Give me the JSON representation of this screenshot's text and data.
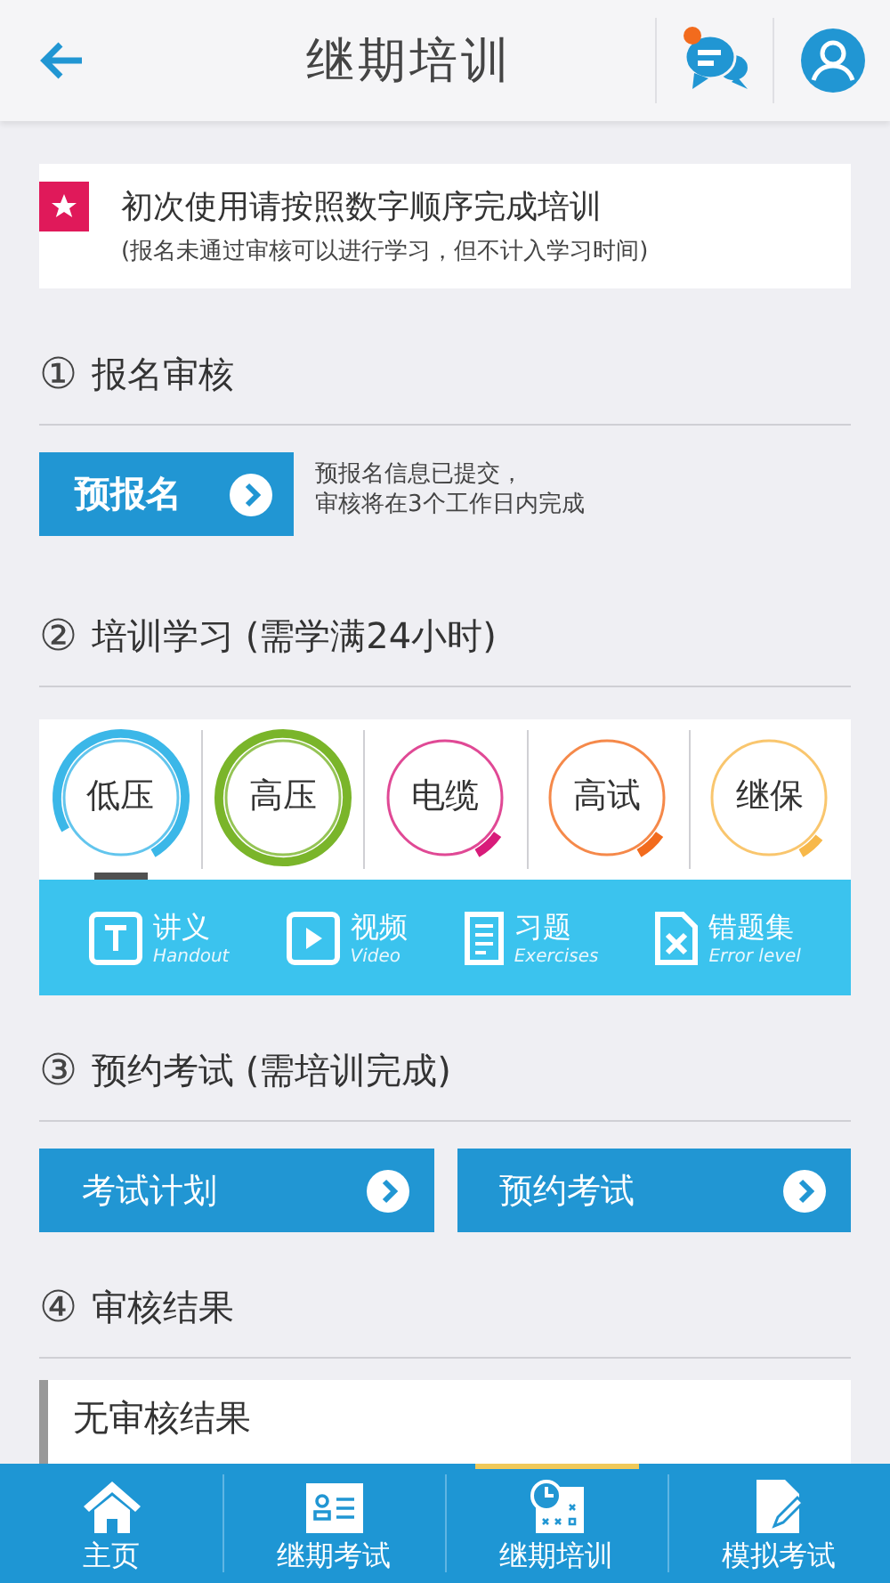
{
  "header": {
    "title": "继期培训",
    "has_unread": true
  },
  "notice": {
    "title": "初次使用请按照数字顺序完成培训",
    "subtitle": "(报名未通过审核可以进行学习，但不计入学习时间)"
  },
  "step1": {
    "number": "①",
    "title": "报名审核",
    "button": "预报名",
    "note_lines": [
      "预报名信息已提交，",
      "审核将在3个工作日内完成"
    ]
  },
  "step2": {
    "number": "②",
    "title": "培训学习 (需学满24小时)",
    "courses": [
      {
        "label": "低压",
        "selected": true,
        "level": 0.75,
        "color": "#3bb7e8"
      },
      {
        "label": "高压",
        "selected": false,
        "level": 1,
        "color": "#7ab52a"
      },
      {
        "label": "电缆",
        "selected": false,
        "level": 0.07,
        "color": "#d81b7a"
      },
      {
        "label": "高试",
        "selected": false,
        "level": 0.07,
        "color": "#f26b1d"
      },
      {
        "label": "继保",
        "selected": false,
        "level": 0.06,
        "color": "#f7b84a"
      }
    ],
    "tools": [
      {
        "kind": "handout",
        "label": "讲义",
        "sublabel": "Handout"
      },
      {
        "kind": "video",
        "label": "视频",
        "sublabel": "Video"
      },
      {
        "kind": "exercises",
        "label": "习题",
        "sublabel": "Exercises"
      },
      {
        "kind": "errors",
        "label": "错题集",
        "sublabel": "Error level"
      }
    ]
  },
  "step3": {
    "number": "③",
    "title": "预约考试 (需培训完成)",
    "buttons": [
      "考试计划",
      "预约考试"
    ]
  },
  "step4": {
    "number": "④",
    "title": "审核结果",
    "result": "无审核结果"
  },
  "nav": [
    {
      "kind": "home",
      "label": "主页",
      "selected": false
    },
    {
      "kind": "exam",
      "label": "继期考试",
      "selected": false
    },
    {
      "kind": "training",
      "label": "继期培训",
      "selected": true
    },
    {
      "kind": "mock",
      "label": "模拟考试",
      "selected": false
    }
  ]
}
